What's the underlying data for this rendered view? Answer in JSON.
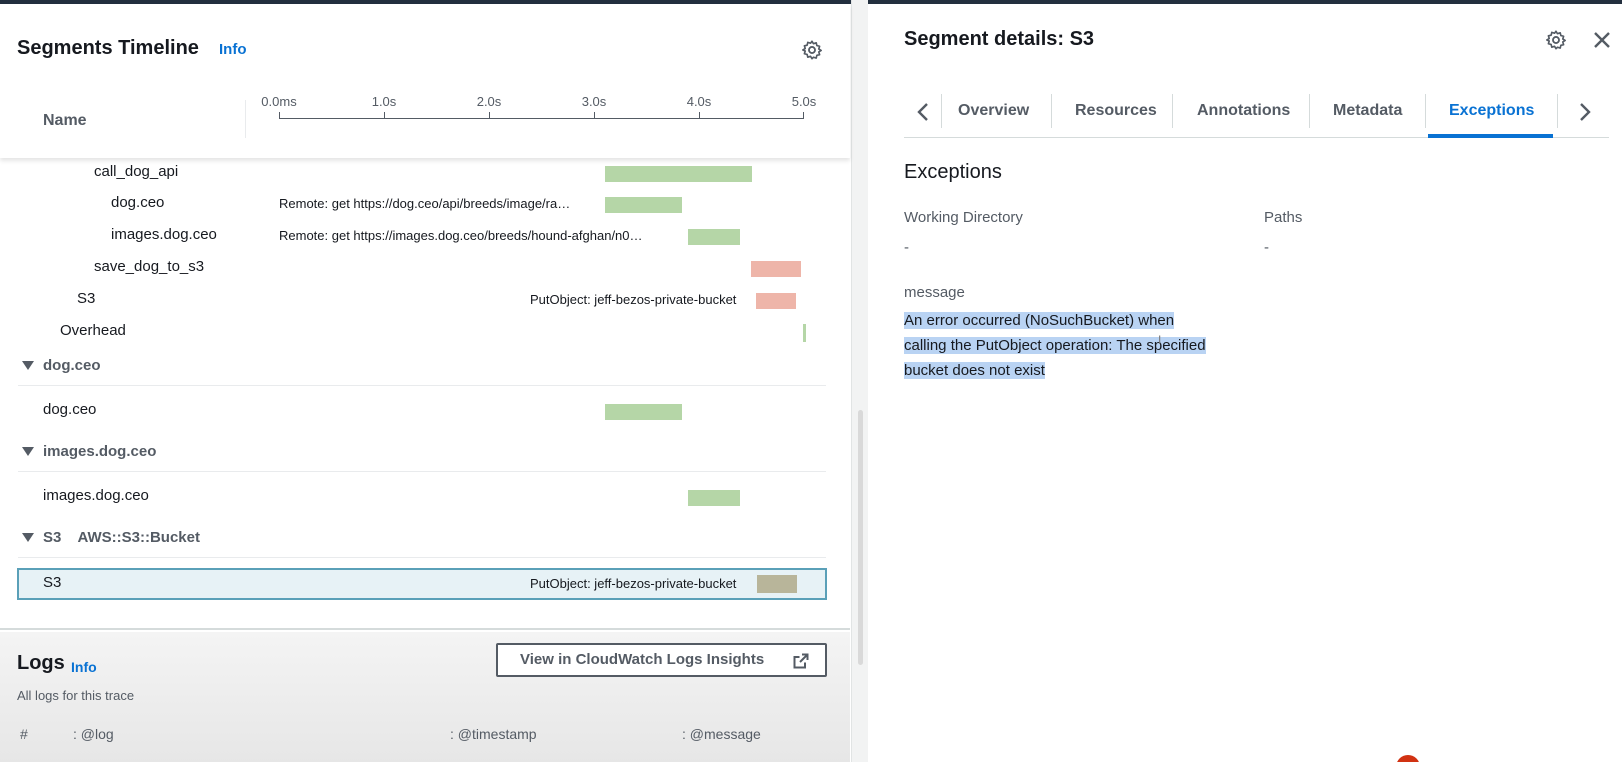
{
  "timeline": {
    "title": "Segments Timeline",
    "info": "Info",
    "name_col": "Name",
    "ticks": [
      "0.0ms",
      "1.0s",
      "2.0s",
      "3.0s",
      "4.0s",
      "5.0s"
    ],
    "rows": [
      {
        "name": "call_dog_api",
        "desc": "",
        "bar": "green"
      },
      {
        "name": "dog.ceo",
        "desc": "Remote: get https://dog.ceo/api/breeds/image/ra…",
        "bar": "green"
      },
      {
        "name": "images.dog.ceo",
        "desc": "Remote: get https://images.dog.ceo/breeds/hound-afghan/n0…",
        "bar": "green"
      },
      {
        "name": "save_dog_to_s3",
        "desc": "",
        "bar": "red"
      },
      {
        "name": "S3",
        "desc": "PutObject: jeff-bezos-private-bucket",
        "bar": "red"
      },
      {
        "name": "Overhead",
        "desc": "",
        "bar": "green"
      }
    ],
    "groups": [
      {
        "name": "dog.ceo",
        "child": "dog.ceo",
        "desc": ""
      },
      {
        "name": "images.dog.ceo",
        "child": "images.dog.ceo",
        "desc": ""
      },
      {
        "name": "S3    AWS::S3::Bucket",
        "child": "S3",
        "desc": "PutObject: jeff-bezos-private-bucket"
      }
    ]
  },
  "logs": {
    "title": "Logs",
    "info": "Info",
    "subtitle": "All logs for this trace",
    "button": "View in CloudWatch Logs Insights",
    "columns": [
      "#",
      ": @log",
      ": @timestamp",
      ": @message"
    ]
  },
  "details": {
    "title": "Segment details: S3",
    "tabs": [
      "Overview",
      "Resources",
      "Annotations",
      "Metadata",
      "Exceptions"
    ],
    "active_tab": "Exceptions",
    "section": "Exceptions",
    "working_dir_label": "Working Directory",
    "working_dir_value": "-",
    "paths_label": "Paths",
    "paths_value": "-",
    "message_label": "message",
    "message_lines": [
      "An error occurred (NoSuchBucket) when",
      "calling the PutObject operation: The specified",
      "bucket does not exist"
    ]
  },
  "colors": {
    "accent": "#0972d3",
    "bar_ok": "#b5d6a7",
    "bar_error": "#eeb5a9"
  }
}
